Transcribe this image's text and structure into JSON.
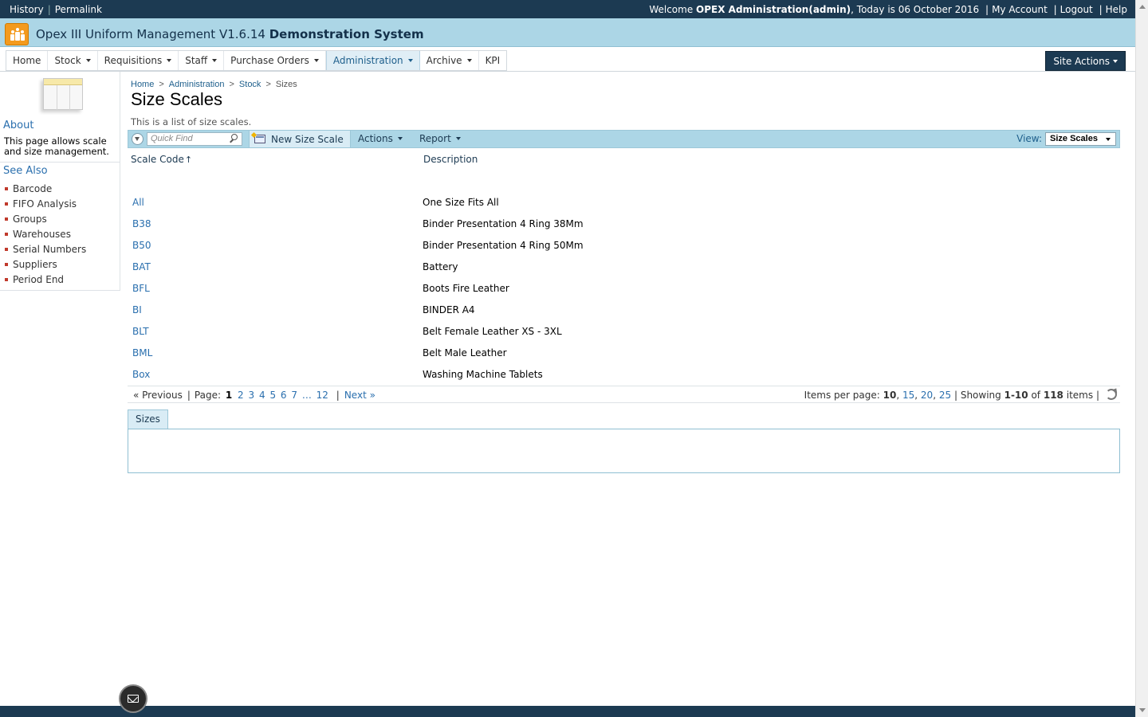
{
  "topbar": {
    "history": "History",
    "permalink": "Permalink",
    "welcome_prefix": "Welcome",
    "user": "OPEX Administration(admin)",
    "today": ", Today is 06 October 2016",
    "my_account": "My Account",
    "logout": "Logout",
    "help": "Help"
  },
  "app": {
    "title": "Opex III Uniform Management V1.6.14",
    "system": "Demonstration System"
  },
  "nav": {
    "items": [
      "Home",
      "Stock",
      "Requisitions",
      "Staff",
      "Purchase Orders",
      "Administration",
      "Archive",
      "KPI"
    ],
    "site_actions": "Site Actions"
  },
  "sidebar": {
    "about_title": "About",
    "about_text": "This page allows scale and size management.",
    "see_also_title": "See Also",
    "links": [
      "Barcode",
      "FIFO Analysis",
      "Groups",
      "Warehouses",
      "Serial Numbers",
      "Suppliers",
      "Period End"
    ]
  },
  "breadcrumb": [
    "Home",
    "Administration",
    "Stock",
    "Sizes"
  ],
  "page": {
    "title": "Size Scales",
    "description": "This is a list of size scales."
  },
  "toolbar": {
    "quick_find_placeholder": "Quick Find",
    "new_label": "New Size Scale",
    "actions_label": "Actions",
    "report_label": "Report",
    "view_label": "View:",
    "view_value": "Size Scales"
  },
  "grid": {
    "columns": [
      "Scale Code",
      "Description"
    ],
    "sort_indicator": "↑",
    "rows": [
      {
        "code": "All",
        "description": "One Size Fits All"
      },
      {
        "code": "B38",
        "description": "Binder Presentation 4 Ring 38Mm"
      },
      {
        "code": "B50",
        "description": "Binder Presentation 4 Ring 50Mm"
      },
      {
        "code": "BAT",
        "description": "Battery"
      },
      {
        "code": "BFL",
        "description": "Boots Fire Leather"
      },
      {
        "code": "BI",
        "description": "BINDER A4"
      },
      {
        "code": "BLT",
        "description": "Belt Female Leather XS - 3XL"
      },
      {
        "code": "BML",
        "description": "Belt Male Leather"
      },
      {
        "code": "Box",
        "description": "Washing Machine Tablets"
      }
    ]
  },
  "pager": {
    "previous": "« Previous",
    "page_label": "Page:",
    "current": "1",
    "pages": [
      "2",
      "3",
      "4",
      "5",
      "6",
      "7"
    ],
    "ellipsis": "…",
    "last": "12",
    "next": "Next »",
    "items_per_page_label": "Items per page:",
    "per_page_current": "10",
    "per_page_options": [
      "15",
      "20",
      "25"
    ],
    "showing_label": "Showing",
    "showing_range": "1-10",
    "of_label": "of",
    "total": "118",
    "items_label": "items"
  },
  "tabs": [
    "Sizes"
  ],
  "colors": {
    "dark_bar": "#1c3a52",
    "title_bar": "#acd6e6",
    "link": "#2a6fae",
    "logo": "#f39a1e"
  }
}
